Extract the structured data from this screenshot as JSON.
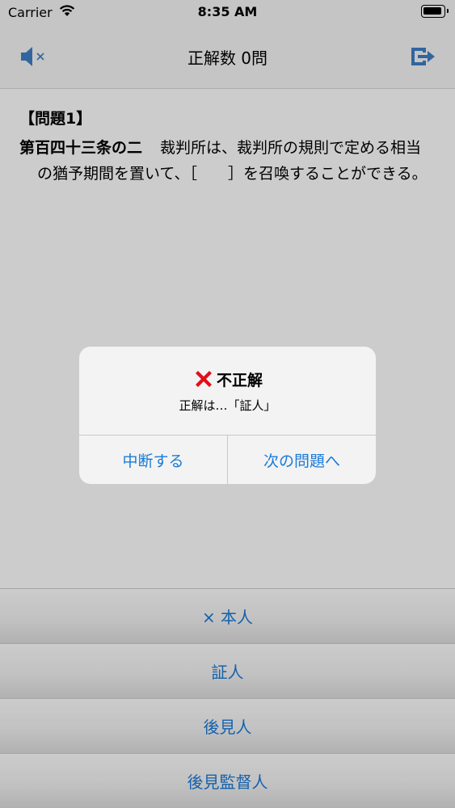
{
  "status_bar": {
    "carrier": "Carrier",
    "time": "8:35 AM"
  },
  "nav": {
    "title": "正解数 0問",
    "left_icon": "speaker-muted-icon",
    "right_icon": "exit-icon"
  },
  "question": {
    "number": "【問題1】",
    "article": "第百四十三条の二",
    "text": "裁判所は、裁判所の規則で定める相当の猶予期間を置いて、［　　］を召喚することができる。"
  },
  "answers": [
    {
      "label": "× 本人"
    },
    {
      "label": "証人"
    },
    {
      "label": "後見人"
    },
    {
      "label": "後見監督人"
    }
  ],
  "alert": {
    "icon": "red-x-icon",
    "title": "不正解",
    "message": "正解は…「証人」",
    "buttons": [
      {
        "label": "中断する"
      },
      {
        "label": "次の問題へ"
      }
    ]
  },
  "colors": {
    "accent": "#1a7ad8",
    "nav_icon": "#3f7fc7",
    "error": "#e0101b"
  }
}
